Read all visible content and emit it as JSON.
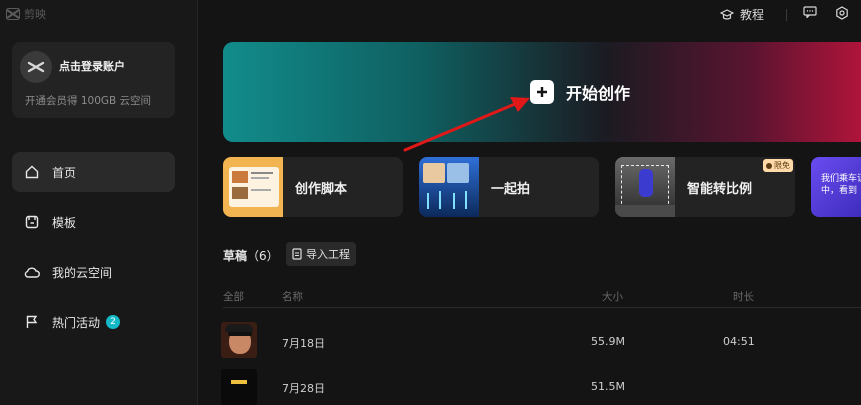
{
  "app": {
    "name": "剪映"
  },
  "account": {
    "login_label": "点击登录账户",
    "vip_promo": "开通会员得 100GB 云空间"
  },
  "sidebar": {
    "items": [
      {
        "label": "首页",
        "icon": "home-icon",
        "active": true
      },
      {
        "label": "模板",
        "icon": "template-icon"
      },
      {
        "label": "我的云空间",
        "icon": "cloud-icon"
      },
      {
        "label": "热门活动",
        "icon": "flag-icon",
        "badge": "2"
      }
    ]
  },
  "topbar": {
    "tutorial_label": "教程",
    "feedback_icon": "feedback-icon",
    "settings_icon": "settings-icon"
  },
  "hero": {
    "label": "开始创作",
    "icon": "plus-icon"
  },
  "features": [
    {
      "label": "创作脚本"
    },
    {
      "label": "一起拍"
    },
    {
      "label": "智能转比例",
      "tag": "限免"
    },
    {
      "label": "我们乘车...中，看到",
      "line1": "我们乘车证",
      "line2": "中，看到"
    }
  ],
  "drafts": {
    "title": "草稿",
    "count": "（6）",
    "import_label": "导入工程",
    "columns": {
      "all": "全部",
      "name": "名称",
      "size": "大小",
      "duration": "时长"
    },
    "rows": [
      {
        "name": "7月18日",
        "size": "55.9M",
        "duration": "04:51"
      },
      {
        "name": "7月28日",
        "size": "51.5M",
        "duration": ""
      }
    ]
  },
  "colors": {
    "accent": "#14b8c6",
    "annotation_arrow": "#e01818"
  }
}
